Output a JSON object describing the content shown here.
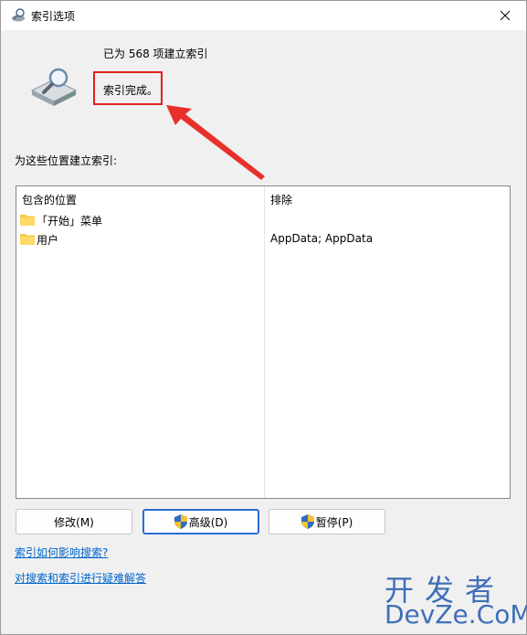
{
  "window": {
    "title": "索引选项",
    "close_icon": "close-icon"
  },
  "status": {
    "count_text": "已为 568 项建立索引",
    "state_text": "索引完成。"
  },
  "locations": {
    "section_label": "为这些位置建立索引:",
    "columns": {
      "included": "包含的位置",
      "excluded": "排除"
    },
    "rows": [
      {
        "name": "「开始」菜单",
        "exclude": ""
      },
      {
        "name": "用户",
        "exclude": "AppData; AppData"
      }
    ]
  },
  "buttons": {
    "modify": "修改(M)",
    "advanced": "高级(D)",
    "pause": "暂停(P)"
  },
  "links": {
    "how_index_affects": "索引如何影响搜索?",
    "troubleshoot": "对搜索和索引进行疑难解答"
  },
  "watermark": {
    "top": "开发者",
    "bottom": "DevZe.CoM"
  },
  "colors": {
    "accent": "#2a6dd2",
    "link": "#0066cc",
    "highlight": "#e02020",
    "folder": "#f7c94a"
  }
}
